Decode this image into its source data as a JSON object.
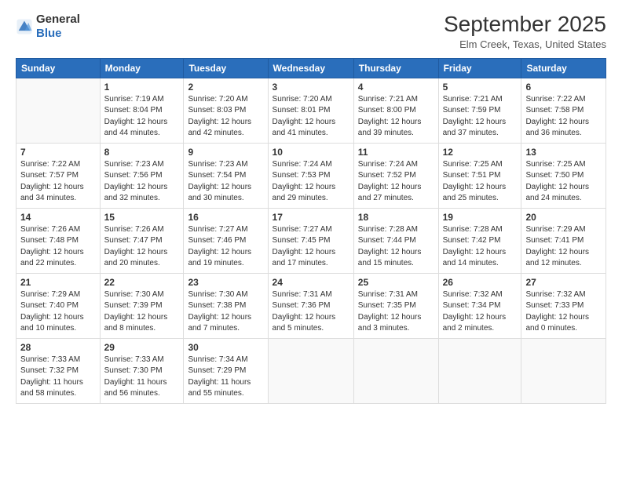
{
  "logo": {
    "general": "General",
    "blue": "Blue"
  },
  "header": {
    "title": "September 2025",
    "subtitle": "Elm Creek, Texas, United States"
  },
  "weekdays": [
    "Sunday",
    "Monday",
    "Tuesday",
    "Wednesday",
    "Thursday",
    "Friday",
    "Saturday"
  ],
  "weeks": [
    [
      {
        "day": "",
        "info": ""
      },
      {
        "day": "1",
        "info": "Sunrise: 7:19 AM\nSunset: 8:04 PM\nDaylight: 12 hours\nand 44 minutes."
      },
      {
        "day": "2",
        "info": "Sunrise: 7:20 AM\nSunset: 8:03 PM\nDaylight: 12 hours\nand 42 minutes."
      },
      {
        "day": "3",
        "info": "Sunrise: 7:20 AM\nSunset: 8:01 PM\nDaylight: 12 hours\nand 41 minutes."
      },
      {
        "day": "4",
        "info": "Sunrise: 7:21 AM\nSunset: 8:00 PM\nDaylight: 12 hours\nand 39 minutes."
      },
      {
        "day": "5",
        "info": "Sunrise: 7:21 AM\nSunset: 7:59 PM\nDaylight: 12 hours\nand 37 minutes."
      },
      {
        "day": "6",
        "info": "Sunrise: 7:22 AM\nSunset: 7:58 PM\nDaylight: 12 hours\nand 36 minutes."
      }
    ],
    [
      {
        "day": "7",
        "info": "Sunrise: 7:22 AM\nSunset: 7:57 PM\nDaylight: 12 hours\nand 34 minutes."
      },
      {
        "day": "8",
        "info": "Sunrise: 7:23 AM\nSunset: 7:56 PM\nDaylight: 12 hours\nand 32 minutes."
      },
      {
        "day": "9",
        "info": "Sunrise: 7:23 AM\nSunset: 7:54 PM\nDaylight: 12 hours\nand 30 minutes."
      },
      {
        "day": "10",
        "info": "Sunrise: 7:24 AM\nSunset: 7:53 PM\nDaylight: 12 hours\nand 29 minutes."
      },
      {
        "day": "11",
        "info": "Sunrise: 7:24 AM\nSunset: 7:52 PM\nDaylight: 12 hours\nand 27 minutes."
      },
      {
        "day": "12",
        "info": "Sunrise: 7:25 AM\nSunset: 7:51 PM\nDaylight: 12 hours\nand 25 minutes."
      },
      {
        "day": "13",
        "info": "Sunrise: 7:25 AM\nSunset: 7:50 PM\nDaylight: 12 hours\nand 24 minutes."
      }
    ],
    [
      {
        "day": "14",
        "info": "Sunrise: 7:26 AM\nSunset: 7:48 PM\nDaylight: 12 hours\nand 22 minutes."
      },
      {
        "day": "15",
        "info": "Sunrise: 7:26 AM\nSunset: 7:47 PM\nDaylight: 12 hours\nand 20 minutes."
      },
      {
        "day": "16",
        "info": "Sunrise: 7:27 AM\nSunset: 7:46 PM\nDaylight: 12 hours\nand 19 minutes."
      },
      {
        "day": "17",
        "info": "Sunrise: 7:27 AM\nSunset: 7:45 PM\nDaylight: 12 hours\nand 17 minutes."
      },
      {
        "day": "18",
        "info": "Sunrise: 7:28 AM\nSunset: 7:44 PM\nDaylight: 12 hours\nand 15 minutes."
      },
      {
        "day": "19",
        "info": "Sunrise: 7:28 AM\nSunset: 7:42 PM\nDaylight: 12 hours\nand 14 minutes."
      },
      {
        "day": "20",
        "info": "Sunrise: 7:29 AM\nSunset: 7:41 PM\nDaylight: 12 hours\nand 12 minutes."
      }
    ],
    [
      {
        "day": "21",
        "info": "Sunrise: 7:29 AM\nSunset: 7:40 PM\nDaylight: 12 hours\nand 10 minutes."
      },
      {
        "day": "22",
        "info": "Sunrise: 7:30 AM\nSunset: 7:39 PM\nDaylight: 12 hours\nand 8 minutes."
      },
      {
        "day": "23",
        "info": "Sunrise: 7:30 AM\nSunset: 7:38 PM\nDaylight: 12 hours\nand 7 minutes."
      },
      {
        "day": "24",
        "info": "Sunrise: 7:31 AM\nSunset: 7:36 PM\nDaylight: 12 hours\nand 5 minutes."
      },
      {
        "day": "25",
        "info": "Sunrise: 7:31 AM\nSunset: 7:35 PM\nDaylight: 12 hours\nand 3 minutes."
      },
      {
        "day": "26",
        "info": "Sunrise: 7:32 AM\nSunset: 7:34 PM\nDaylight: 12 hours\nand 2 minutes."
      },
      {
        "day": "27",
        "info": "Sunrise: 7:32 AM\nSunset: 7:33 PM\nDaylight: 12 hours\nand 0 minutes."
      }
    ],
    [
      {
        "day": "28",
        "info": "Sunrise: 7:33 AM\nSunset: 7:32 PM\nDaylight: 11 hours\nand 58 minutes."
      },
      {
        "day": "29",
        "info": "Sunrise: 7:33 AM\nSunset: 7:30 PM\nDaylight: 11 hours\nand 56 minutes."
      },
      {
        "day": "30",
        "info": "Sunrise: 7:34 AM\nSunset: 7:29 PM\nDaylight: 11 hours\nand 55 minutes."
      },
      {
        "day": "",
        "info": ""
      },
      {
        "day": "",
        "info": ""
      },
      {
        "day": "",
        "info": ""
      },
      {
        "day": "",
        "info": ""
      }
    ]
  ]
}
